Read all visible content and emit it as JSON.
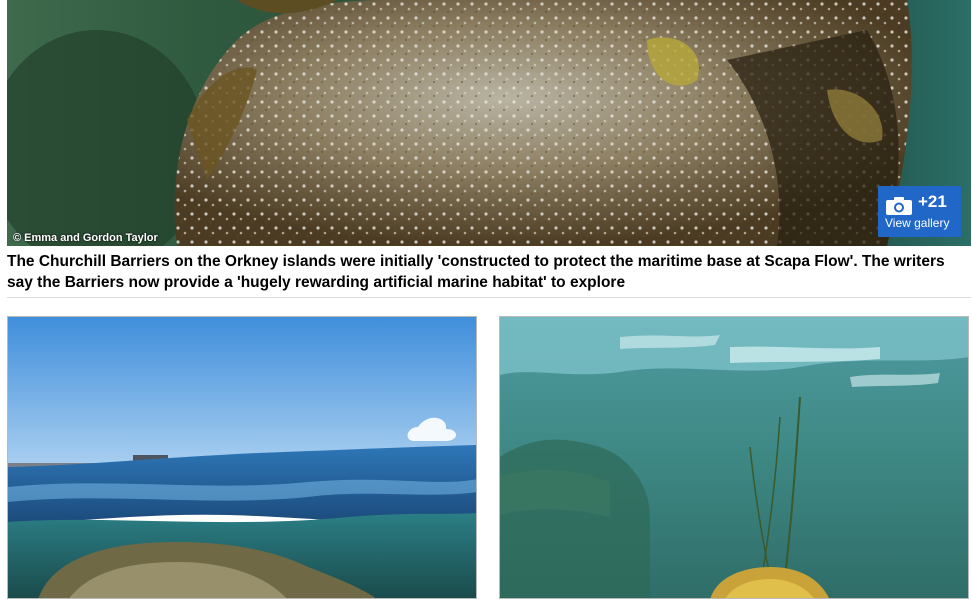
{
  "hero": {
    "credit": "© Emma and Gordon Taylor",
    "gallery_count": "+21",
    "gallery_label": "View gallery",
    "gallery_icon": "camera-icon"
  },
  "caption": "The Churchill Barriers on the Orkney islands were initially 'constructed to protect the maritime base at Scapa Flow'. The writers say the Barriers now provide a 'hugely rewarding artificial marine habitat' to explore",
  "colors": {
    "gallery_button": "#2067c8",
    "caption_text": "#000000"
  }
}
